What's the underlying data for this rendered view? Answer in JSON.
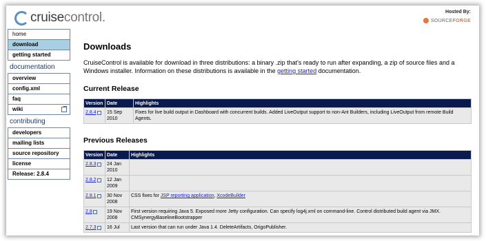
{
  "header": {
    "logo_main": "cruise",
    "logo_dim": "control",
    "logo_dot": ".",
    "hosted_label": "Hosted By:",
    "sf_light": "SOURCE",
    "sf_bold": "FORGE"
  },
  "sidebar": {
    "items_top": [
      {
        "label": "home"
      },
      {
        "label": "download"
      },
      {
        "label": "getting started"
      }
    ],
    "doc_heading": "documentation",
    "items_doc": [
      {
        "label": "overview"
      },
      {
        "label": "config.xml"
      },
      {
        "label": "faq"
      },
      {
        "label": "wiki"
      }
    ],
    "contrib_heading": "contributing",
    "items_contrib": [
      {
        "label": "developers"
      },
      {
        "label": "mailing lists"
      },
      {
        "label": "source repository"
      },
      {
        "label": "license"
      }
    ],
    "release": "Release: 2.8.4"
  },
  "main": {
    "title": "Downloads",
    "intro_pre": "CruiseControl is available for download in three distributions: a binary .zip that's ready to run after expanding, a zip of source files and a Windows installer. Information on these distributions is available in the ",
    "intro_link": "getting started",
    "intro_post": " documentation.",
    "current_heading": "Current Release",
    "previous_heading": "Previous Releases",
    "col_version": "Version",
    "col_date": "Date",
    "col_highlights": "Highlights",
    "current": {
      "version": "2.8.4",
      "date": "15 Sep 2010",
      "highlights": "Fixes for live build output in Dashboard with concurrent builds. Added LiveOutput support to non-Ant Builders, including LiveOutput from remote Build Agents."
    },
    "previous": [
      {
        "version": "2.8.3",
        "date": "24 Jan 2010",
        "pre": "",
        "link1": "",
        "mid": "",
        "link2": "",
        "post": ""
      },
      {
        "version": "2.8.2",
        "date": "12 Jan 2009",
        "pre": "",
        "link1": "",
        "mid": "",
        "link2": "",
        "post": ""
      },
      {
        "version": "2.8.1",
        "date": "30 Nov 2008",
        "pre": "CSS fixes for ",
        "link1": "JSP reporting application",
        "mid": ", ",
        "link2": "XcodeBuilder",
        "post": ""
      },
      {
        "version": "2.8",
        "date": "19 Nov 2008",
        "pre": "First version requiring Java 5. Exposed more Jetty configuration. Can specify log4j.xml on command-line. Control distributed build agent via JMX. CMSynergyBaselineBootstrapper",
        "link1": "",
        "mid": "",
        "link2": "",
        "post": ""
      },
      {
        "version": "2.7.3",
        "date": "16 Jul",
        "pre": "Last version that can run under Java 1.4. DeleteArtifacts, OrigoPublisher.",
        "link1": "",
        "mid": "",
        "link2": "",
        "post": ""
      }
    ]
  }
}
